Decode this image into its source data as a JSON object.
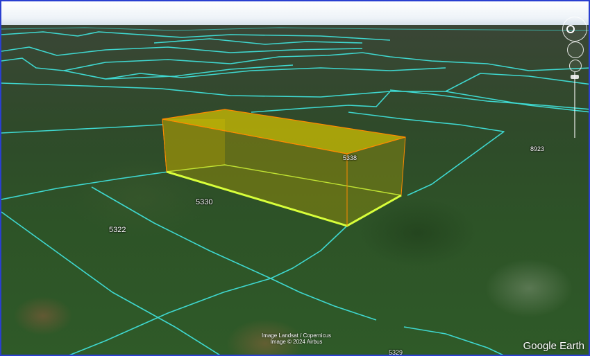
{
  "map": {
    "parcels": [
      {
        "id": "5330"
      },
      {
        "id": "5322"
      },
      {
        "id": "5338"
      },
      {
        "id": "8923"
      },
      {
        "id": "5329"
      }
    ],
    "attribution": {
      "line1": "Image Landsat / Copernicus",
      "line2": "Image © 2024 Airbus"
    },
    "brand": "Google Earth"
  },
  "colors": {
    "parcel_line": "#3fd8d0",
    "highlight_edge": "#d8ff3a",
    "box_fill": "#c8b400",
    "box_edge": "#ff8a00"
  }
}
